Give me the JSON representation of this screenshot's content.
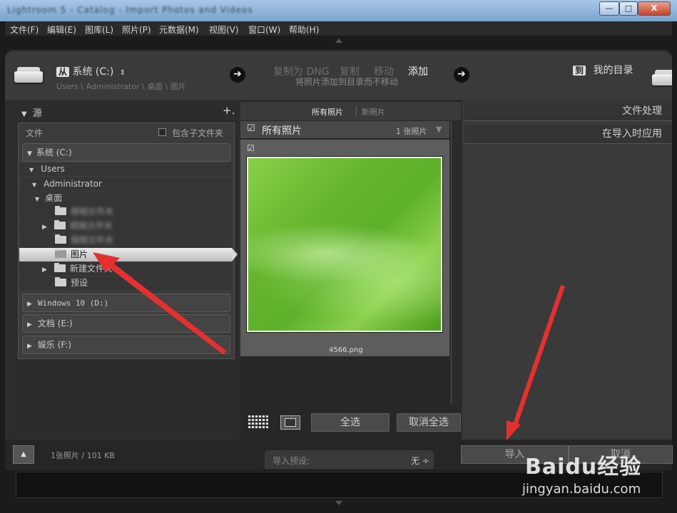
{
  "window": {
    "title": "Lightroom 5 - Catalog - Import Photos and Videos",
    "minimize": "—",
    "maximize": "□",
    "close": "X"
  },
  "menu": [
    "文件(F)",
    "编辑(E)",
    "图库(L)",
    "照片(P)",
    "元数据(M)",
    "视图(V)",
    "窗口(W)",
    "帮助(H)"
  ],
  "header": {
    "from_chip": "从",
    "source_label": "系统 (C:)",
    "source_path": "Users \\ Administrator \\ 桌面 \\ 图片",
    "modes": [
      "复制为 DNG",
      "复制",
      "移动",
      "添加"
    ],
    "active_mode": "添加",
    "mode_desc": "将照片添加到目录而不移动",
    "to_chip": "到",
    "dest_label": "我的目录"
  },
  "source_panel": {
    "title": "源",
    "add_icon": "+.",
    "files_label": "文件",
    "include_subfolders": "包含子文件夹",
    "volumes": [
      {
        "label": "系统 (C:)"
      },
      {
        "label": "Windows 10 (D:)"
      },
      {
        "label": "文档 (E:)"
      },
      {
        "label": "娱乐 (F:)"
      }
    ],
    "tree": {
      "users": "Users",
      "administrator": "Administrator",
      "desktop": "桌面",
      "blurred_1": "模糊文件夹",
      "blurred_2": "模糊文件夹",
      "blurred_3": "模糊文件夹",
      "selected": "图片",
      "new_folder": "新建文件夹",
      "presets": "预设"
    }
  },
  "center": {
    "tab_all": "所有照片",
    "tab_new": "新照片",
    "grid_title": "所有照片",
    "photo_count": "1 张照片",
    "thumb_filename": "4566.png",
    "select_all": "全选",
    "deselect_all": "取消全选"
  },
  "right_panel": {
    "file_handling": "文件处理",
    "apply_during_import": "在导入时应用"
  },
  "bottom": {
    "summary": "1张照片 / 101 KB",
    "preset_label": "导入预设:",
    "preset_value": "无 ÷",
    "import_button": "导入",
    "cancel_button": "取消"
  },
  "watermark": {
    "brand": "Baidu经验",
    "url": "jingyan.baidu.com"
  },
  "colors": {
    "annotation_arrow": "#e53030",
    "selected_row": "#e0e0e0",
    "background": "#2d2d2d"
  }
}
